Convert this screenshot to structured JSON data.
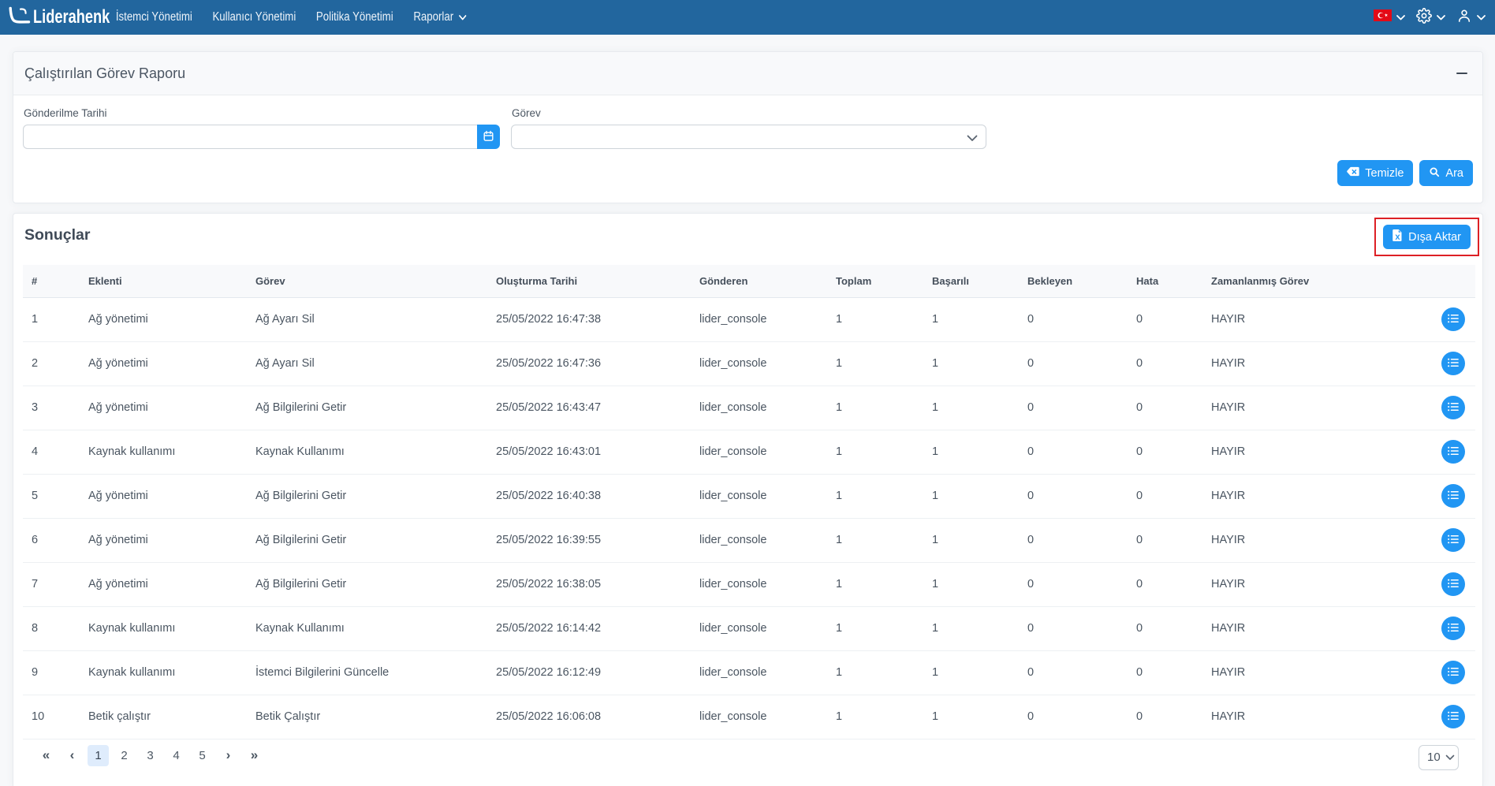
{
  "navbar": {
    "brand": "Liderahenk",
    "items": [
      {
        "label": "İstemci Yönetimi",
        "caret": false
      },
      {
        "label": "Kullanıcı Yönetimi",
        "caret": false
      },
      {
        "label": "Politika Yönetimi",
        "caret": false
      },
      {
        "label": "Raporlar",
        "caret": true
      }
    ]
  },
  "filter": {
    "title": "Çalıştırılan Görev Raporu",
    "fields": {
      "date": {
        "label": "Gönderilme Tarihi",
        "value": "",
        "placeholder": ""
      },
      "task": {
        "label": "Görev",
        "value": ""
      }
    },
    "buttons": {
      "clear": "Temizle",
      "search": "Ara"
    }
  },
  "results": {
    "title": "Sonuçlar",
    "export_label": "Dışa Aktar",
    "table": {
      "headers": [
        "#",
        "Eklenti",
        "Görev",
        "Oluşturma Tarihi",
        "Gönderen",
        "Toplam",
        "Başarılı",
        "Bekleyen",
        "Hata",
        "Zamanlanmış Görev",
        ""
      ],
      "rows": [
        [
          "1",
          "Ağ yönetimi",
          "Ağ Ayarı Sil",
          "25/05/2022 16:47:38",
          "lider_console",
          "1",
          "1",
          "0",
          "0",
          "HAYIR"
        ],
        [
          "2",
          "Ağ yönetimi",
          "Ağ Ayarı Sil",
          "25/05/2022 16:47:36",
          "lider_console",
          "1",
          "1",
          "0",
          "0",
          "HAYIR"
        ],
        [
          "3",
          "Ağ yönetimi",
          "Ağ Bilgilerini Getir",
          "25/05/2022 16:43:47",
          "lider_console",
          "1",
          "1",
          "0",
          "0",
          "HAYIR"
        ],
        [
          "4",
          "Kaynak kullanımı",
          "Kaynak Kullanımı",
          "25/05/2022 16:43:01",
          "lider_console",
          "1",
          "1",
          "0",
          "0",
          "HAYIR"
        ],
        [
          "5",
          "Ağ yönetimi",
          "Ağ Bilgilerini Getir",
          "25/05/2022 16:40:38",
          "lider_console",
          "1",
          "1",
          "0",
          "0",
          "HAYIR"
        ],
        [
          "6",
          "Ağ yönetimi",
          "Ağ Bilgilerini Getir",
          "25/05/2022 16:39:55",
          "lider_console",
          "1",
          "1",
          "0",
          "0",
          "HAYIR"
        ],
        [
          "7",
          "Ağ yönetimi",
          "Ağ Bilgilerini Getir",
          "25/05/2022 16:38:05",
          "lider_console",
          "1",
          "1",
          "0",
          "0",
          "HAYIR"
        ],
        [
          "8",
          "Kaynak kullanımı",
          "Kaynak Kullanımı",
          "25/05/2022 16:14:42",
          "lider_console",
          "1",
          "1",
          "0",
          "0",
          "HAYIR"
        ],
        [
          "9",
          "Kaynak kullanımı",
          "İstemci Bilgilerini Güncelle",
          "25/05/2022 16:12:49",
          "lider_console",
          "1",
          "1",
          "0",
          "0",
          "HAYIR"
        ],
        [
          "10",
          "Betik çalıştır",
          "Betik Çalıştır",
          "25/05/2022 16:06:08",
          "lider_console",
          "1",
          "1",
          "0",
          "0",
          "HAYIR"
        ]
      ]
    },
    "pagination": {
      "first": "«",
      "prev": "‹",
      "next": "›",
      "last": "»",
      "pages": [
        {
          "label": "1",
          "active": true
        },
        {
          "label": "2",
          "active": false
        },
        {
          "label": "3",
          "active": false
        },
        {
          "label": "4",
          "active": false
        },
        {
          "label": "5",
          "active": false
        }
      ],
      "page_size": "10"
    }
  },
  "colors": {
    "navbar": "#22669e",
    "accent_blue": "#2196f3",
    "annotation_red": "#dd2025",
    "table_header_bg": "#f8f9fb",
    "active_page_bg": "#dfecfc"
  }
}
